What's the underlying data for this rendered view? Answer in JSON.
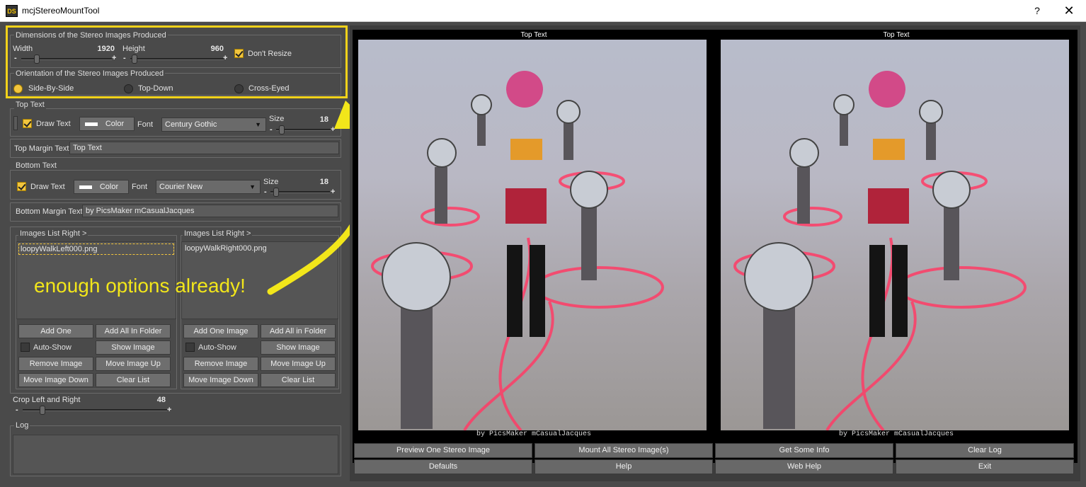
{
  "window": {
    "icon_text": "DS",
    "title": "mcjStereoMountTool",
    "help_glyph": "?",
    "close_glyph": "✕"
  },
  "dimensions": {
    "group_label": "Dimensions of the Stereo Images Produced",
    "width_label": "Width",
    "width_value": "1920",
    "height_label": "Height",
    "height_value": "960",
    "dont_resize_label": "Don't Resize",
    "dont_resize_checked": true
  },
  "orientation": {
    "group_label": "Orientation of the Stereo Images Produced",
    "options": [
      "Side-By-Side",
      "Top-Down",
      "Cross-Eyed"
    ],
    "selected": "Side-By-Side"
  },
  "top_text": {
    "group_label": "Top Text",
    "draw_text_label": "Draw Text",
    "draw_text_checked": true,
    "color_button": "Color",
    "font_label": "Font",
    "font_value": "Century Gothic",
    "size_label": "Size",
    "size_value": "18",
    "margin_label": "Top Margin Text",
    "margin_value": "Top Text"
  },
  "bottom_text": {
    "group_label": "Bottom Text",
    "draw_text_label": "Draw Text",
    "draw_text_checked": true,
    "color_button": "Color",
    "font_label": "Font",
    "font_value": "Courier New",
    "size_label": "Size",
    "size_value": "18",
    "margin_label": "Bottom Margin Text",
    "margin_value": "by PicsMaker mCasualJacques"
  },
  "left_list": {
    "group_label": "Images List Right >",
    "items": [
      "loopyWalkLeft000.png"
    ],
    "buttons": {
      "add_one": "Add One",
      "add_all": "Add All In Folder",
      "auto_show": "Auto-Show",
      "show_image": "Show Image",
      "remove_image": "Remove Image",
      "move_up": "Move Image Up",
      "move_down": "Move Image Down",
      "clear_list": "Clear List"
    }
  },
  "right_list": {
    "group_label": "Images List Right >",
    "items": [
      "loopyWalkRight000.png"
    ],
    "buttons": {
      "add_one": "Add One Image",
      "add_all": "Add All in Folder",
      "auto_show": "Auto-Show",
      "show_image": "Show Image",
      "remove_image": "Remove Image",
      "move_up": "Move Image Up",
      "move_down": "Move Image Down",
      "clear_list": "Clear List"
    }
  },
  "crop": {
    "label": "Crop Left and Right",
    "value": "48"
  },
  "log": {
    "group_label": "Log"
  },
  "annotation": {
    "text": "enough options already!",
    "color": "#f2e61a"
  },
  "preview": {
    "top_text": "Top Text",
    "bottom_text": "by PicsMaker mCasualJacques"
  },
  "action_buttons": {
    "preview_one": "Preview One Stereo Image",
    "mount_all": "Mount All Stereo Image(s)",
    "get_info": "Get Some Info",
    "clear_log": "Clear Log",
    "defaults": "Defaults",
    "help": "Help",
    "web_help": "Web Help",
    "exit": "Exit"
  },
  "colors": {
    "accent": "#f2c53d",
    "highlight": "#f2d21a",
    "panel_bg": "#4a4a4a"
  }
}
